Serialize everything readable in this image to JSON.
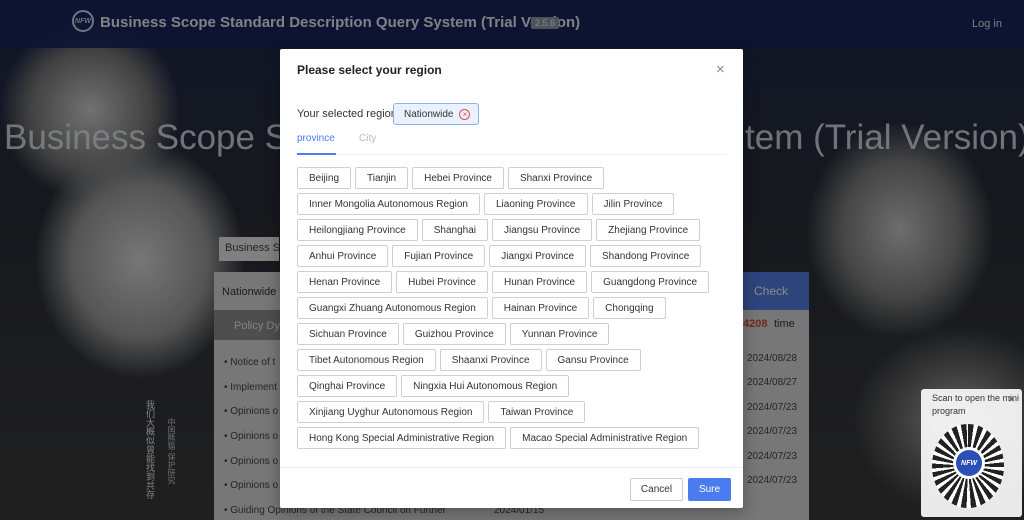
{
  "header": {
    "logo_text": "NFW",
    "app_title": "Business Scope Standard Description Query System (Trial Version)",
    "version": "2.5.6",
    "login_label": "Log in"
  },
  "hero": {
    "left": "Business Scope St",
    "right": "tem (Trial Version)"
  },
  "background": {
    "scope_tab": "Business Sc",
    "scope_select": "Nationwide ▾",
    "check_label": "Check",
    "policy_tab": "Policy Dyn",
    "count_value": "4208",
    "count_unit": "time",
    "news": [
      {
        "title": "Notice of t",
        "date": "2024/08/28"
      },
      {
        "title": "Implement",
        "date": "2024/08/27"
      },
      {
        "title": "Opinions o",
        "date": "2024/07/23"
      },
      {
        "title": "Opinions o",
        "date": "2024/07/23"
      },
      {
        "title": "Opinions o",
        "date": "2024/07/23"
      },
      {
        "title": "Opinions o",
        "date": "2024/07/23"
      }
    ],
    "bottom_item": "Guiding Opinions of the State Council on Further",
    "bottom_date": "2024/01/15",
    "vertical_text": "我们大概似曾能找到共存",
    "vertical_text2": "中国熊猫·保护研究"
  },
  "qr": {
    "text": "Scan to open the mini program",
    "close": "×",
    "logo_text": "NFW"
  },
  "modal": {
    "title": "Please select your region",
    "close": "×",
    "selected_label": "Your selected region:",
    "selected_value": "Nationwide",
    "chip_close": "×",
    "tabs": [
      "province",
      "City"
    ],
    "rows": [
      [
        "Beijing",
        "Tianjin",
        "Hebei Province",
        "Shanxi Province"
      ],
      [
        "Inner Mongolia Autonomous Region",
        "Liaoning Province",
        "Jilin Province"
      ],
      [
        "Heilongjiang Province",
        "Shanghai",
        "Jiangsu Province",
        "Zhejiang Province"
      ],
      [
        "Anhui Province",
        "Fujian Province",
        "Jiangxi Province",
        "Shandong Province"
      ],
      [
        "Henan Province",
        "Hubei Province",
        "Hunan Province",
        "Guangdong Province"
      ],
      [
        "Guangxi Zhuang Autonomous Region",
        "Hainan Province",
        "Chongqing"
      ],
      [
        "Sichuan Province",
        "Guizhou Province",
        "Yunnan Province"
      ],
      [
        "Tibet Autonomous Region",
        "Shaanxi Province",
        "Gansu Province"
      ],
      [
        "Qinghai Province",
        "Ningxia Hui Autonomous Region"
      ],
      [
        "Xinjiang Uyghur Autonomous Region",
        "Taiwan Province"
      ],
      [
        "Hong Kong Special Administrative Region",
        "Macao Special Administrative Region"
      ]
    ],
    "cancel_label": "Cancel",
    "sure_label": "Sure"
  },
  "colors": {
    "accent": "#4a7cf0",
    "header_bg": "#19265c",
    "count_red": "#d7433b"
  }
}
